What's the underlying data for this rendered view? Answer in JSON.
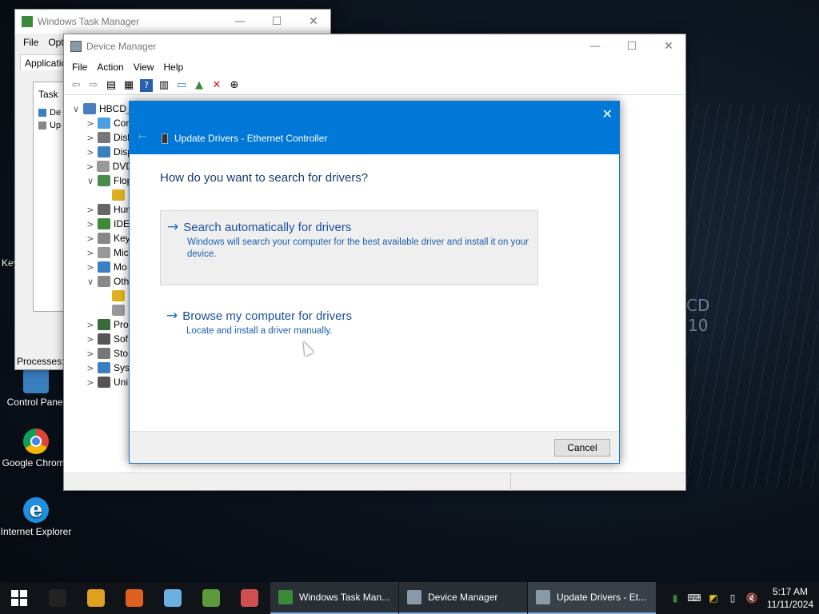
{
  "desktop": {
    "icons": [
      {
        "label": "Control Panel"
      },
      {
        "label": "Google Chrome"
      },
      {
        "label": "Internet Explorer"
      }
    ],
    "partial_label": "Key",
    "background_text": [
      "CD",
      "10"
    ]
  },
  "task_manager": {
    "title": "Windows Task Manager",
    "menu": [
      "File",
      "Opti"
    ],
    "tab": "Applicatio",
    "column": "Task",
    "rows": [
      "De",
      "Up"
    ],
    "status": "Processes:"
  },
  "device_manager": {
    "title": "Device Manager",
    "menu": [
      "File",
      "Action",
      "View",
      "Help"
    ],
    "toolbar_icons": [
      "back-icon",
      "forward-icon",
      "properties-icon",
      "list-icon",
      "help-icon",
      "details-icon",
      "monitor-icon",
      "update-driver-icon",
      "uninstall-icon",
      "download-icon"
    ],
    "tree": [
      {
        "expander": "∨",
        "label": "HBCD_",
        "color": "#4a7dbf"
      },
      {
        "expander": ">",
        "label": "Cor",
        "color": "#4a9fe0"
      },
      {
        "expander": ">",
        "label": "Disl",
        "color": "#777777"
      },
      {
        "expander": ">",
        "label": "Disp",
        "color": "#3a7fc0"
      },
      {
        "expander": ">",
        "label": "DVD",
        "color": "#999999"
      },
      {
        "expander": "∨",
        "label": "Flop",
        "color": "#4a8a4a"
      },
      {
        "expander": "",
        "label": "",
        "color": "#e0b020"
      },
      {
        "expander": ">",
        "label": "Hun",
        "color": "#666666"
      },
      {
        "expander": ">",
        "label": "IDE",
        "color": "#3a8a3a"
      },
      {
        "expander": ">",
        "label": "Key",
        "color": "#888888"
      },
      {
        "expander": ">",
        "label": "Mic",
        "color": "#999999"
      },
      {
        "expander": ">",
        "label": "Mo",
        "color": "#3a7fc0"
      },
      {
        "expander": "∨",
        "label": "Oth",
        "color": "#888888"
      },
      {
        "expander": "",
        "label": "",
        "color": "#e0b020"
      },
      {
        "expander": "",
        "label": "",
        "color": "#999999"
      },
      {
        "expander": ">",
        "label": "Pro",
        "color": "#3a6a3a"
      },
      {
        "expander": ">",
        "label": "Sof",
        "color": "#555555"
      },
      {
        "expander": ">",
        "label": "Sto",
        "color": "#777777"
      },
      {
        "expander": ">",
        "label": "Syst",
        "color": "#3a7fc0"
      },
      {
        "expander": ">",
        "label": "Uni",
        "color": "#555555"
      }
    ]
  },
  "dialog": {
    "title": "Update Drivers - Ethernet Controller",
    "question": "How do you want to search for drivers?",
    "options": [
      {
        "title": "Search automatically for drivers",
        "desc": "Windows will search your computer for the best available driver and install it on your device."
      },
      {
        "title": "Browse my computer for drivers",
        "desc": "Locate and install a driver manually."
      }
    ],
    "cancel_label": "Cancel",
    "close_glyph": "✕",
    "back_glyph": "←",
    "option_arrow": "→"
  },
  "taskbar": {
    "pinned": [
      {
        "icon": "cmd-icon",
        "color": "#222222"
      },
      {
        "icon": "chrome-icon",
        "color": "#e0a020"
      },
      {
        "icon": "firefox-icon",
        "color": "#e06020"
      },
      {
        "icon": "notepad-icon",
        "color": "#6ab0e0"
      },
      {
        "icon": "chart-app-icon",
        "color": "#5a9a3a"
      },
      {
        "icon": "paint-icon",
        "color": "#d05050"
      }
    ],
    "tasks": [
      {
        "label": "Windows Task Man...",
        "color": "#3a8a3a",
        "active": false
      },
      {
        "label": "Device Manager",
        "color": "#8899aa",
        "active": false
      },
      {
        "label": "Update Drivers - Et...",
        "color": "#8899aa",
        "active": true
      }
    ],
    "time": "5:17 AM",
    "date": "11/11/2024"
  },
  "colors": {
    "accent": "#0078d7",
    "link": "#1c4f9e"
  }
}
